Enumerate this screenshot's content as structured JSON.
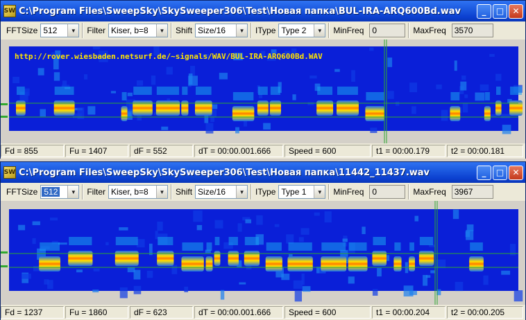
{
  "windows": [
    {
      "title": "C:\\Program Files\\SweepSky\\SkySweeper306\\Test\\Новая папка\\BUL-IRA-ARQ600Bd.wav",
      "app_icon_text": "SW",
      "url_overlay": "http://rover.wiesbaden.netsurf.de/~signals/WAV/BUL-IRA-ARQ600Bd.WAV",
      "toolbar": {
        "fftsize_label": "FFTSize",
        "fftsize_value": "512",
        "filter_label": "Filter",
        "filter_value": "Kiser, b=8",
        "shift_label": "Shift",
        "shift_value": "Size/16",
        "itype_label": "IType",
        "itype_value": "Type 2",
        "minfreq_label": "MinFreq",
        "minfreq_value": "0",
        "maxfreq_label": "MaxFreq",
        "maxfreq_value": "3570"
      },
      "status": {
        "fd": "Fd = 855",
        "fu": "Fu = 1407",
        "df": "dF = 552",
        "dt": "dT = 00:00.001.666",
        "speed": "Speed = 600",
        "t1": "t1 = 00:00.179",
        "t2": "t2 = 00:00.181"
      }
    },
    {
      "title": "C:\\Program Files\\SweepSky\\SkySweeper306\\Test\\Новая папка\\11442_11437.wav",
      "app_icon_text": "SW",
      "url_overlay": "",
      "toolbar": {
        "fftsize_label": "FFTSize",
        "fftsize_value": "512",
        "filter_label": "Filter",
        "filter_value": "Kiser, b=8",
        "shift_label": "Shift",
        "shift_value": "Size/16",
        "itype_label": "IType",
        "itype_value": "Type 1",
        "minfreq_label": "MinFreq",
        "minfreq_value": "0",
        "maxfreq_label": "MaxFreq",
        "maxfreq_value": "3967"
      },
      "status": {
        "fd": "Fd = 1237",
        "fu": "Fu = 1860",
        "df": "dF = 623",
        "dt": "dT = 00:00.001.666",
        "speed": "Speed = 600",
        "t1": "t1 = 00:00.204",
        "t2": "t2 = 00:00.205"
      }
    }
  ],
  "titlebar_buttons": {
    "minimize": "_",
    "maximize": "□",
    "close": "✕"
  },
  "dropdown_arrow": "▼",
  "colors": {
    "spectrum_bg": "#0a1fd8",
    "signal_core": "#ff7a00",
    "signal_edge": "#ffe000",
    "cursor": "#2fa82f"
  }
}
